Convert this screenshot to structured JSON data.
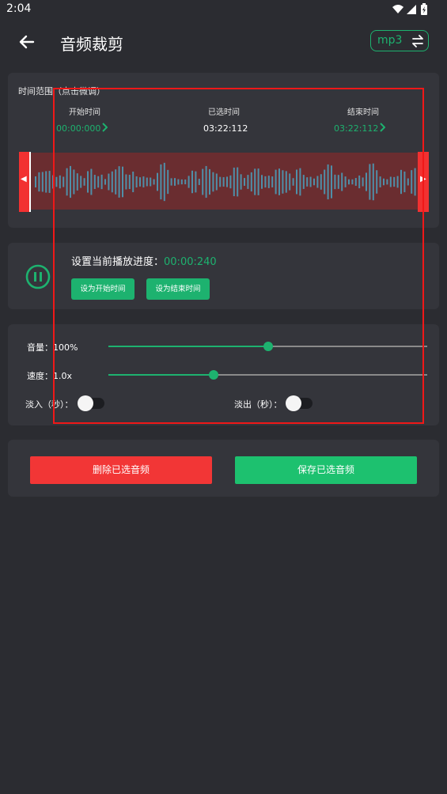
{
  "status_bar": {
    "time": "2:04",
    "icons": [
      "wifi-icon",
      "signal-icon",
      "battery-icon"
    ]
  },
  "app_bar": {
    "title": "音频裁剪",
    "format": "mp3",
    "back_icon": "back-arrow-icon",
    "swap_icon": "swap-icon"
  },
  "range": {
    "title": "时间范围（点击微调）",
    "start_label": "开始时间",
    "start_value": "00:00:000",
    "selected_label": "已选时间",
    "selected_value": "03:22:112",
    "end_label": "结束时间",
    "end_value": "03:22:112"
  },
  "playback": {
    "label": "设置当前播放进度：",
    "value": "00:00:240",
    "set_start": "设为开始时间",
    "set_end": "设为结束时间",
    "icon": "pause-icon"
  },
  "adjust": {
    "volume_label": "音量：",
    "volume_value": "100%",
    "volume_fraction": 0.5,
    "speed_label": "速度：",
    "speed_value": "1.0x",
    "speed_fraction": 0.33,
    "fade_in_label": "淡入（秒）：",
    "fade_in_on": false,
    "fade_out_label": "淡出（秒）：",
    "fade_out_on": false
  },
  "actions": {
    "delete": "删除已选音频",
    "save": "保存已选音频"
  },
  "colors": {
    "accent": "#1db26f",
    "danger": "#f23636",
    "background": "#2b2c31",
    "card": "#34353b",
    "waveform": "#4f8fa8"
  }
}
